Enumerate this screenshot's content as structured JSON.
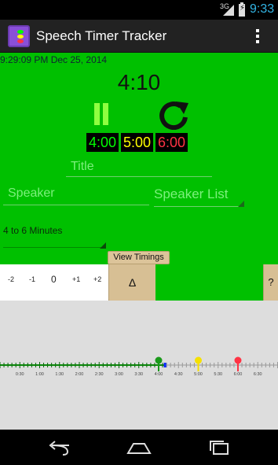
{
  "status_bar": {
    "network": "3G",
    "time": "9:33"
  },
  "action_bar": {
    "title": "Speech Timer Tracker"
  },
  "main": {
    "datetime": "9:29:09 PM   Dec 25, 2014",
    "timer": "4:10",
    "green_time": "4:00",
    "yellow_time": "5:00",
    "red_time": "6:00",
    "title_placeholder": "Title",
    "speaker_placeholder": "Speaker",
    "speaker_list_label": "Speaker List",
    "timing_option": "4 to 6 Minutes",
    "view_timings_label": "View Timings"
  },
  "adjust": {
    "m2": "-2",
    "m1": "-1",
    "zero": "0",
    "p1": "+1",
    "p2": "+2"
  },
  "delta_label": "Δ",
  "help_label": "?",
  "timeline": {
    "ticks": [
      "0:30",
      "1:00",
      "1:30",
      "2:00",
      "2:30",
      "3:00",
      "3:30",
      "4:00",
      "4:30",
      "5:00",
      "5:30",
      "6:00",
      "6:30"
    ],
    "progress_minutes": 4.17,
    "green_marker_minutes": 4.0,
    "yellow_marker_minutes": 5.0,
    "red_marker_minutes": 6.0
  },
  "colors": {
    "background_green": "#00c000",
    "green_light": "#00ff00",
    "yellow_light": "#ffff00",
    "red_light": "#ff3344"
  }
}
